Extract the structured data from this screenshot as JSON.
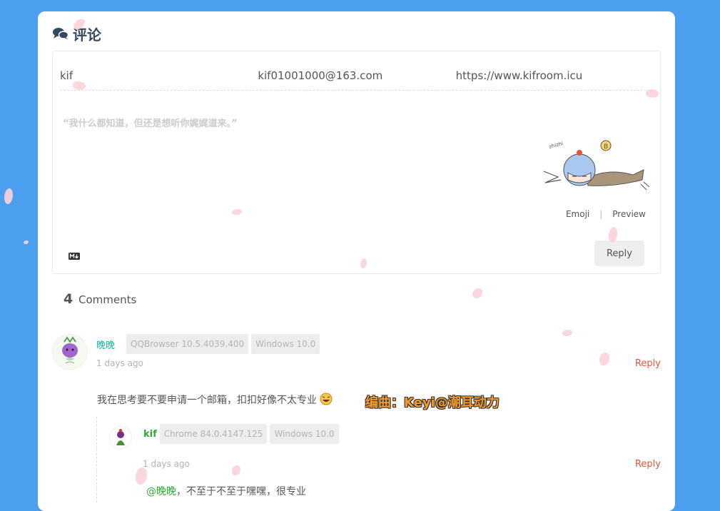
{
  "section": {
    "title": "评论"
  },
  "form": {
    "nick_value": "kif",
    "mail_value": "kif01001000@163.com",
    "link_value": "https://www.kifroom.icu",
    "comment_placeholder": "“我什么都知道，但还是想听你娓娓道来。”",
    "emoji_label": "Emoji",
    "preview_label": "Preview",
    "reply_label": "Reply"
  },
  "comments_header": {
    "count": "4",
    "label": "Comments"
  },
  "comments": [
    {
      "nick": "晚晚",
      "browser": "QQBrowser 10.5.4039.400",
      "os": "Windows 10.0",
      "time": "1 days ago",
      "reply_label": "Reply",
      "text": "我在思考要不要申请一个邮箱，扣扣好像不太专业"
    },
    {
      "nick": "kif",
      "browser": "Chrome 84.0.4147.125",
      "os": "Windows 10.0",
      "time": "1 days ago",
      "reply_label": "Reply",
      "mention": "@晚晚",
      "text": "，不至于不至于嘿嘿，很专业"
    }
  ],
  "overlay": {
    "lyrics": "编曲：Keyi@潮耳动力"
  },
  "colors": {
    "background": "#4b9fee",
    "nick_accent": "#1fb29a",
    "reply_link": "#e5543c",
    "mention": "#30a830"
  }
}
